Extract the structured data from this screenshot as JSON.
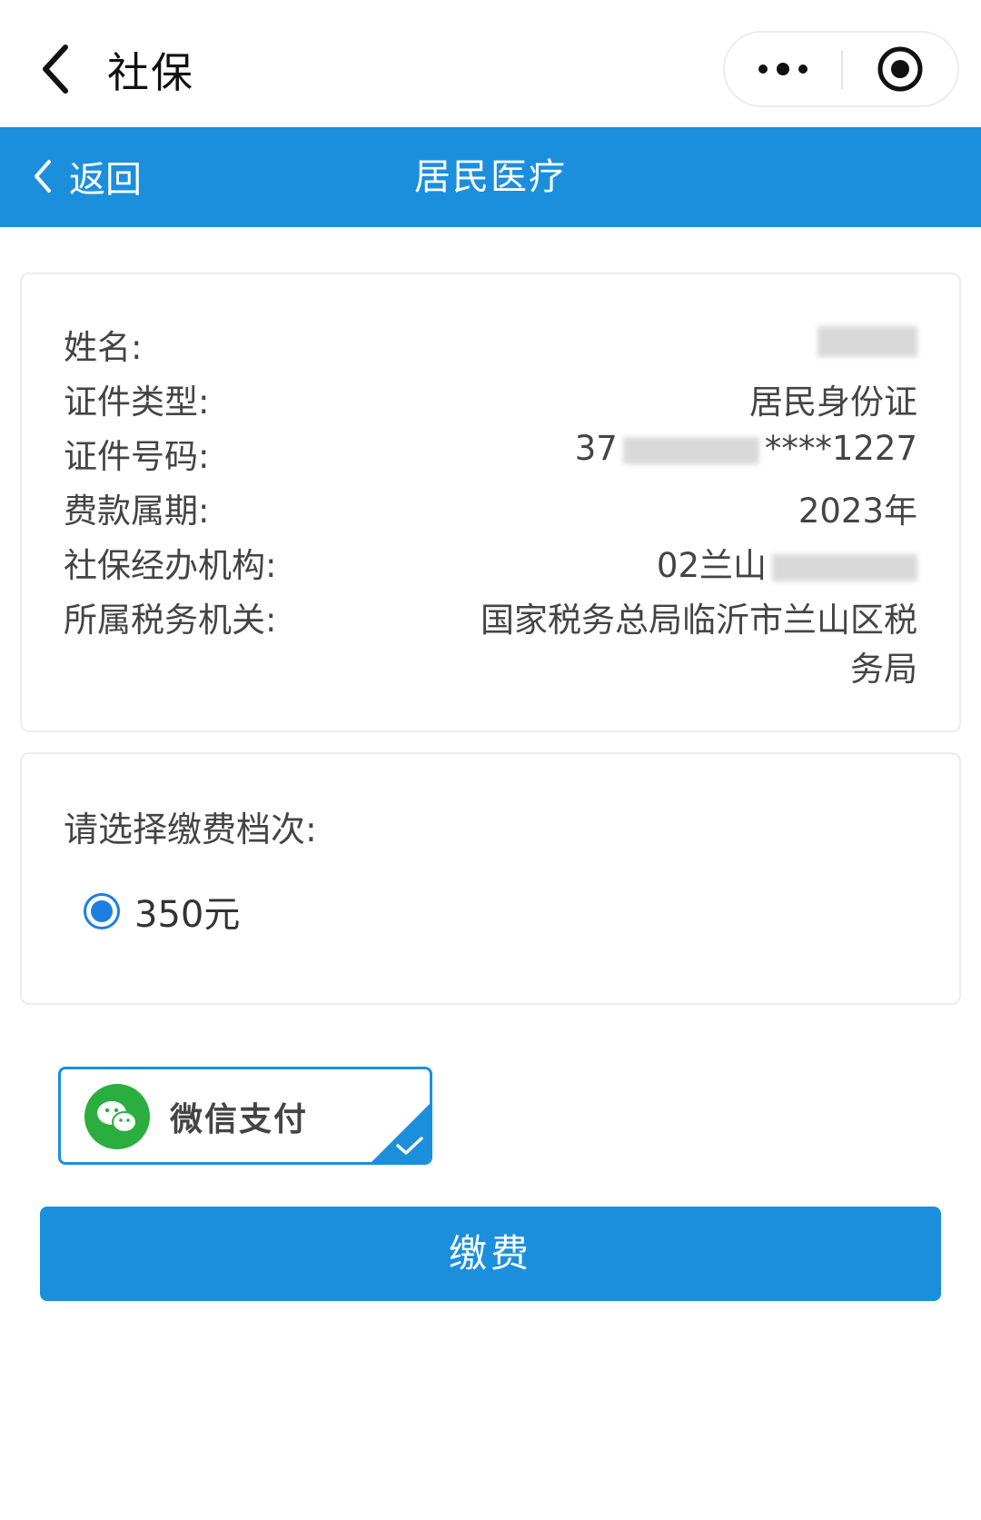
{
  "topbar": {
    "title": "社保",
    "back_icon": "chevron-left-icon",
    "more_icon": "more-dots-icon",
    "close_icon": "target-circle-icon"
  },
  "navbar": {
    "back_label": "返回",
    "title": "居民医疗",
    "color": "#1b8fdc"
  },
  "info": {
    "name_label": "姓名:",
    "name_value": "",
    "id_type_label": "证件类型:",
    "id_type_value": "居民身份证",
    "id_no_label": "证件号码:",
    "id_no_prefix": "37",
    "id_no_suffix": "****1227",
    "period_label": "费款属期:",
    "period_value": "2023年",
    "agency_label": "社保经办机构:",
    "agency_value": "02兰山",
    "tax_label": "所属税务机关:",
    "tax_value_line1": "国家税务总局临沂市兰山区税",
    "tax_value_line2": "务局"
  },
  "tier": {
    "title": "请选择缴费档次:",
    "options": [
      {
        "label": "350元",
        "selected": true
      }
    ]
  },
  "payment": {
    "method_label": "微信支付",
    "method_icon": "wechat-icon",
    "selected": true,
    "wechat_color": "#2aae3f"
  },
  "submit": {
    "label": "缴费"
  }
}
